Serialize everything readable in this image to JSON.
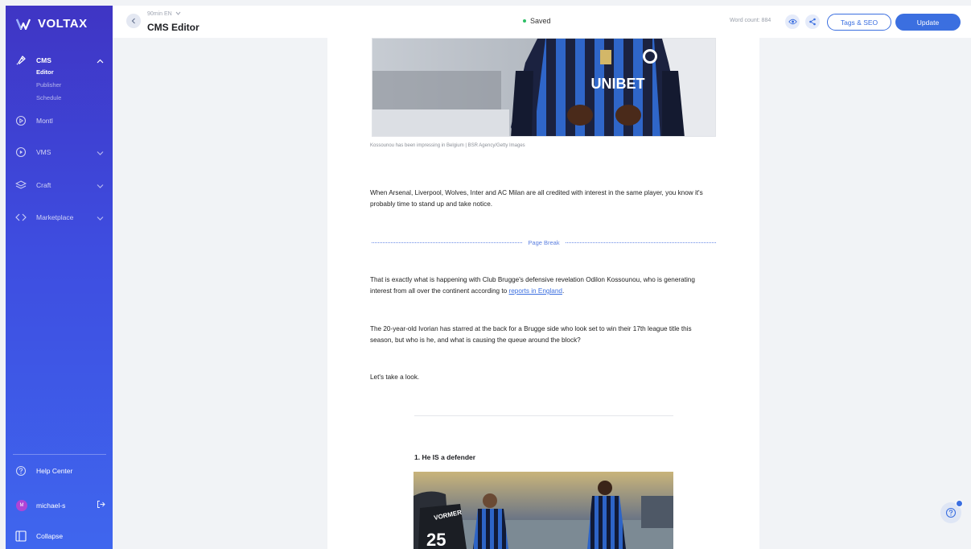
{
  "app": {
    "logo_text": "VOLTAX"
  },
  "sidebar": {
    "cms_label": "CMS",
    "cms_subitems": [
      "Editor",
      "Publisher",
      "Schedule"
    ],
    "montl_label": "Montl",
    "vms_label": "VMS",
    "craft_label": "Craft",
    "marketplace_label": "Marketplace",
    "help_label": "Help Center",
    "user_name": "michael-s",
    "user_initial": "M",
    "collapse_label": "Collapse"
  },
  "topbar": {
    "site_selector": "90min EN",
    "title": "CMS Editor",
    "saved_status": "Saved",
    "word_count": "Word count: 884",
    "tags_seo_label": "Tags & SEO",
    "update_label": "Update"
  },
  "article": {
    "image_caption": "Kossounou has been impressing in Belgium | BSR Agency/Getty Images",
    "para1": "When Arsenal, Liverpool, Wolves, Inter and AC Milan are all credited with interest in the same player, you know it's probably time to stand up and take notice.",
    "page_break_label": "Page Break",
    "para2_text": "That is exactly what is happening with Club Brugge's defensive revelation Odilon Kossounou, who is generating interest from all over the continent according to ",
    "para2_link": "reports in England",
    "para2_end": ".",
    "para3": "The 20-year-old Ivorian has starred at the back for a Brugge side who look set to win their 17th league title this season, but who is he, and what is causing the queue around the block?",
    "para4": "Let's take a look.",
    "heading1": "1.  He IS a defender",
    "shirt_sponsor": "UNIBET",
    "player_name": "VORMER",
    "player_number": "25"
  },
  "colors": {
    "accent": "#3b6fe0",
    "sidebar_top": "#3f35c4",
    "sidebar_bottom": "#3f66ee",
    "saved_dot": "#2dbe66"
  }
}
